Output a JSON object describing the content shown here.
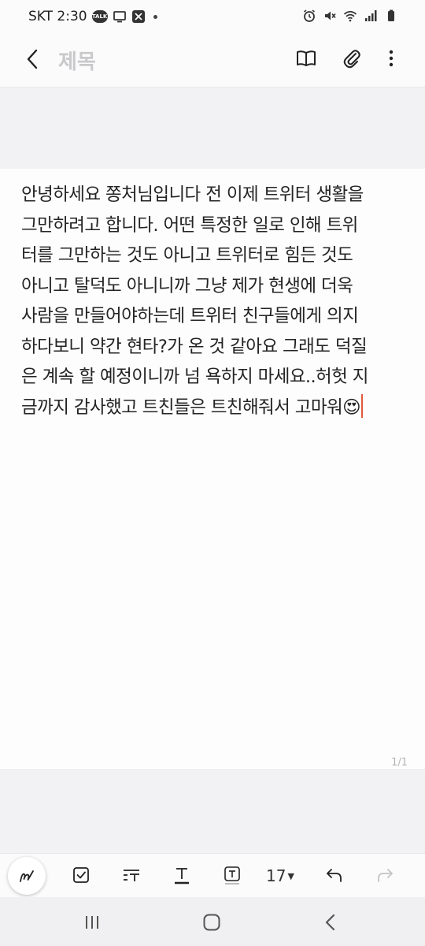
{
  "status_bar": {
    "carrier_time": "SKT 2:30",
    "talk_badge": "TALK",
    "icons": [
      "kakaotalk-icon",
      "tv-icon",
      "capcut-icon",
      "more-dot",
      "alarm-icon",
      "mute-icon",
      "wifi-icon",
      "signal-icon",
      "battery-icon"
    ]
  },
  "app_bar": {
    "title": "제목",
    "icons": [
      "back-icon",
      "book-icon",
      "attach-icon",
      "more-icon"
    ]
  },
  "note": {
    "lines": [
      "안녕하세요 쫑처님입니다 전 이제 트위터 생활을",
      "그만하려고 합니다. 어떤 특정한 일로 인해 트위",
      "터를 그만하는 것도 아니고 트위터로 힘든 것도",
      "아니고 탈덕도 아니니까 그냥 제가 현생에 더욱",
      "사람을 만들어야하는데 트위터 친구들에게 의지",
      "하다보니 약간 현타?가 온 것 같아요 그래도 덕질",
      "은 계속 할 예정이니까 넘 욕하지 마세요..허헛 지",
      "금까지 감사했고 트친들은 트친해줘서 고마워😍"
    ],
    "page_indicator": "1/1"
  },
  "toolbar": {
    "font_size": "17",
    "icons": [
      "pen-icon",
      "checkbox-icon",
      "text-format-icon",
      "text-style-icon",
      "text-box-icon",
      "undo-icon",
      "redo-icon"
    ]
  },
  "nav_bar": {
    "icons": [
      "recents-icon",
      "home-icon",
      "back-nav-icon"
    ]
  },
  "colors": {
    "accent_cursor": "#e05a3a",
    "title_placeholder": "#c9c9cc",
    "background_gray": "#f2f2f4"
  }
}
